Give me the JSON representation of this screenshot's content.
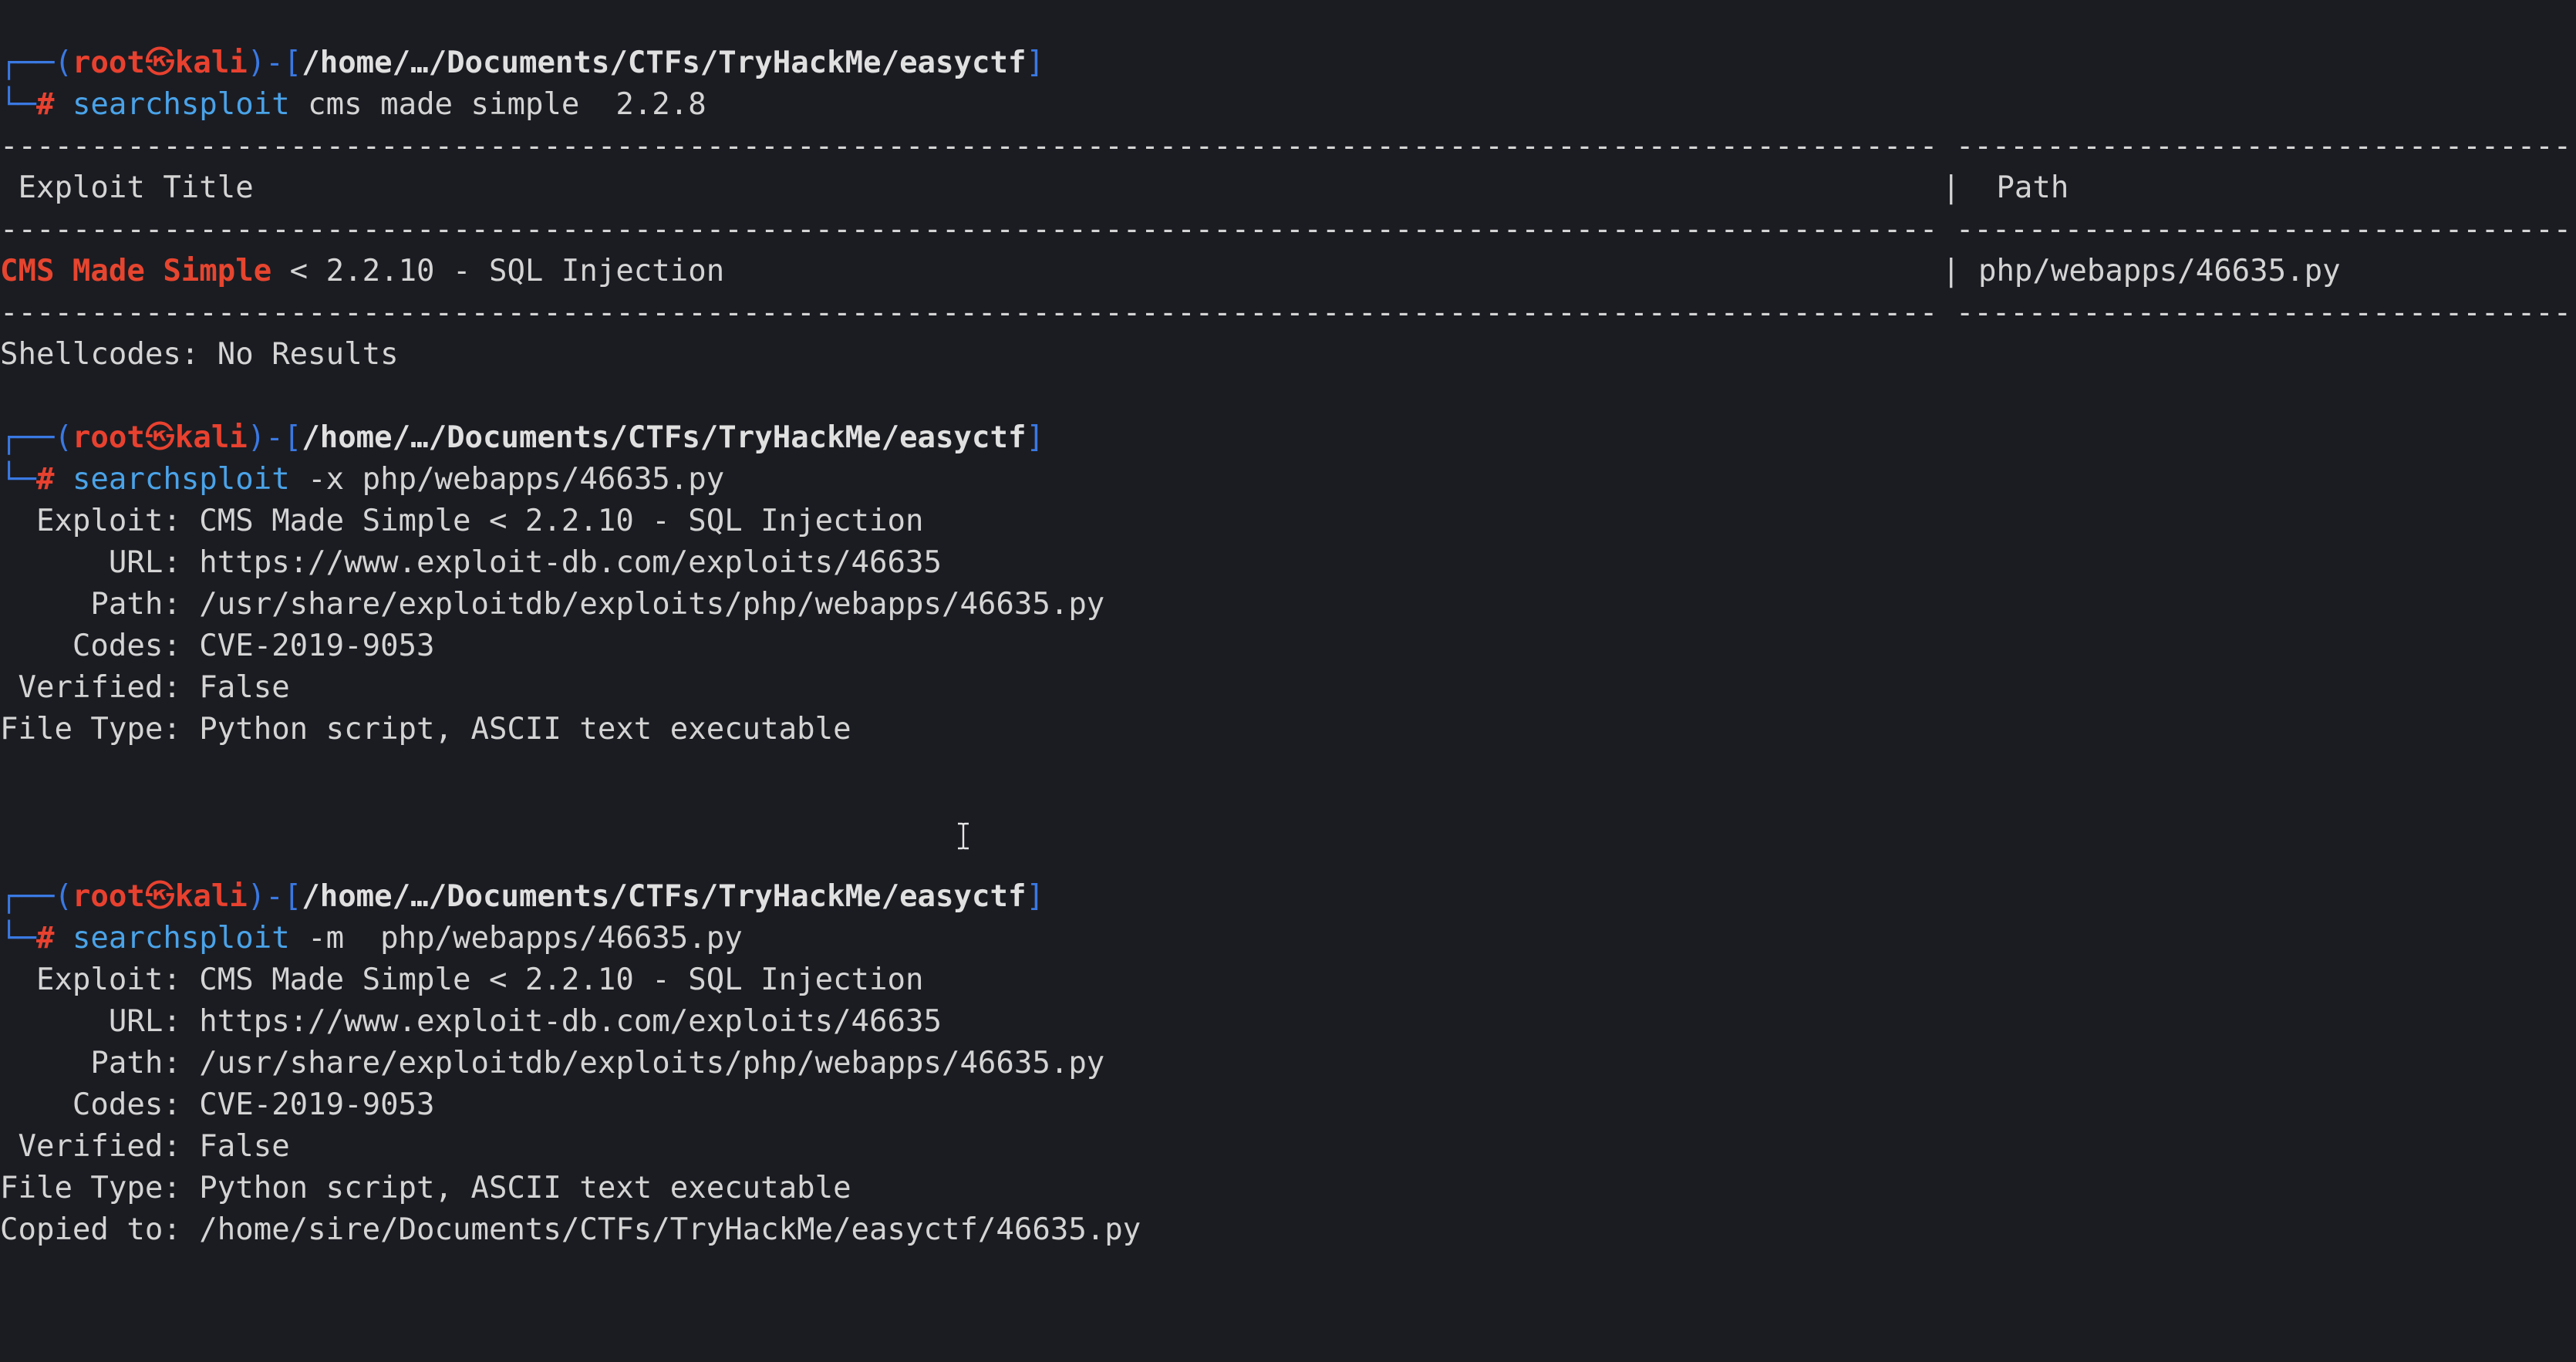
{
  "prompts": [
    {
      "user": "root",
      "at_symbol": "㉿",
      "host": "kali",
      "cwd": "/home/…/Documents/CTFs/TryHackMe/easyctf",
      "hash": "#",
      "command": "searchsploit",
      "args": " cms made simple  2.2.8"
    },
    {
      "user": "root",
      "at_symbol": "㉿",
      "host": "kali",
      "cwd": "/home/…/Documents/CTFs/TryHackMe/easyctf",
      "hash": "#",
      "command": "searchsploit",
      "args": " -x php/webapps/46635.py"
    },
    {
      "user": "root",
      "at_symbol": "㉿",
      "host": "kali",
      "cwd": "/home/…/Documents/CTFs/TryHackMe/easyctf",
      "hash": "#",
      "command": "searchsploit",
      "args": " -m  php/webapps/46635.py"
    }
  ],
  "search_results": {
    "divider_left": "-----------------------------------------------------------------------------------------------------------",
    "divider_right": "----------------------------------",
    "header_title": " Exploit Title",
    "header_path": "|  Path",
    "row_highlight": "CMS Made Simple",
    "row_rest": " < 2.2.10 - SQL Injection",
    "row_path": "| php/webapps/46635.py",
    "shellcodes": "Shellcodes: No Results"
  },
  "examine": {
    "exploit": "  Exploit: CMS Made Simple < 2.2.10 - SQL Injection",
    "url": "      URL: https://www.exploit-db.com/exploits/46635",
    "path": "     Path: /usr/share/exploitdb/exploits/php/webapps/46635.py",
    "codes": "    Codes: CVE-2019-9053",
    "verified": " Verified: False",
    "filetype": "File Type: Python script, ASCII text executable"
  },
  "mirror": {
    "exploit": "  Exploit: CMS Made Simple < 2.2.10 - SQL Injection",
    "url": "      URL: https://www.exploit-db.com/exploits/46635",
    "path": "     Path: /usr/share/exploitdb/exploits/php/webapps/46635.py",
    "codes": "    Codes: CVE-2019-9053",
    "verified": " Verified: False",
    "filetype": "File Type: Python script, ASCII text executable",
    "copied": "Copied to: /home/sire/Documents/CTFs/TryHackMe/easyctf/46635.py"
  },
  "colors": {
    "background": "#1b1c22",
    "prompt_frame": "#3a79e3",
    "prompt_user": "#e8412f",
    "command": "#4aa3e8",
    "text": "#d4d4d4"
  },
  "icons": {
    "cursor": "text-cursor-ibeam-icon"
  }
}
